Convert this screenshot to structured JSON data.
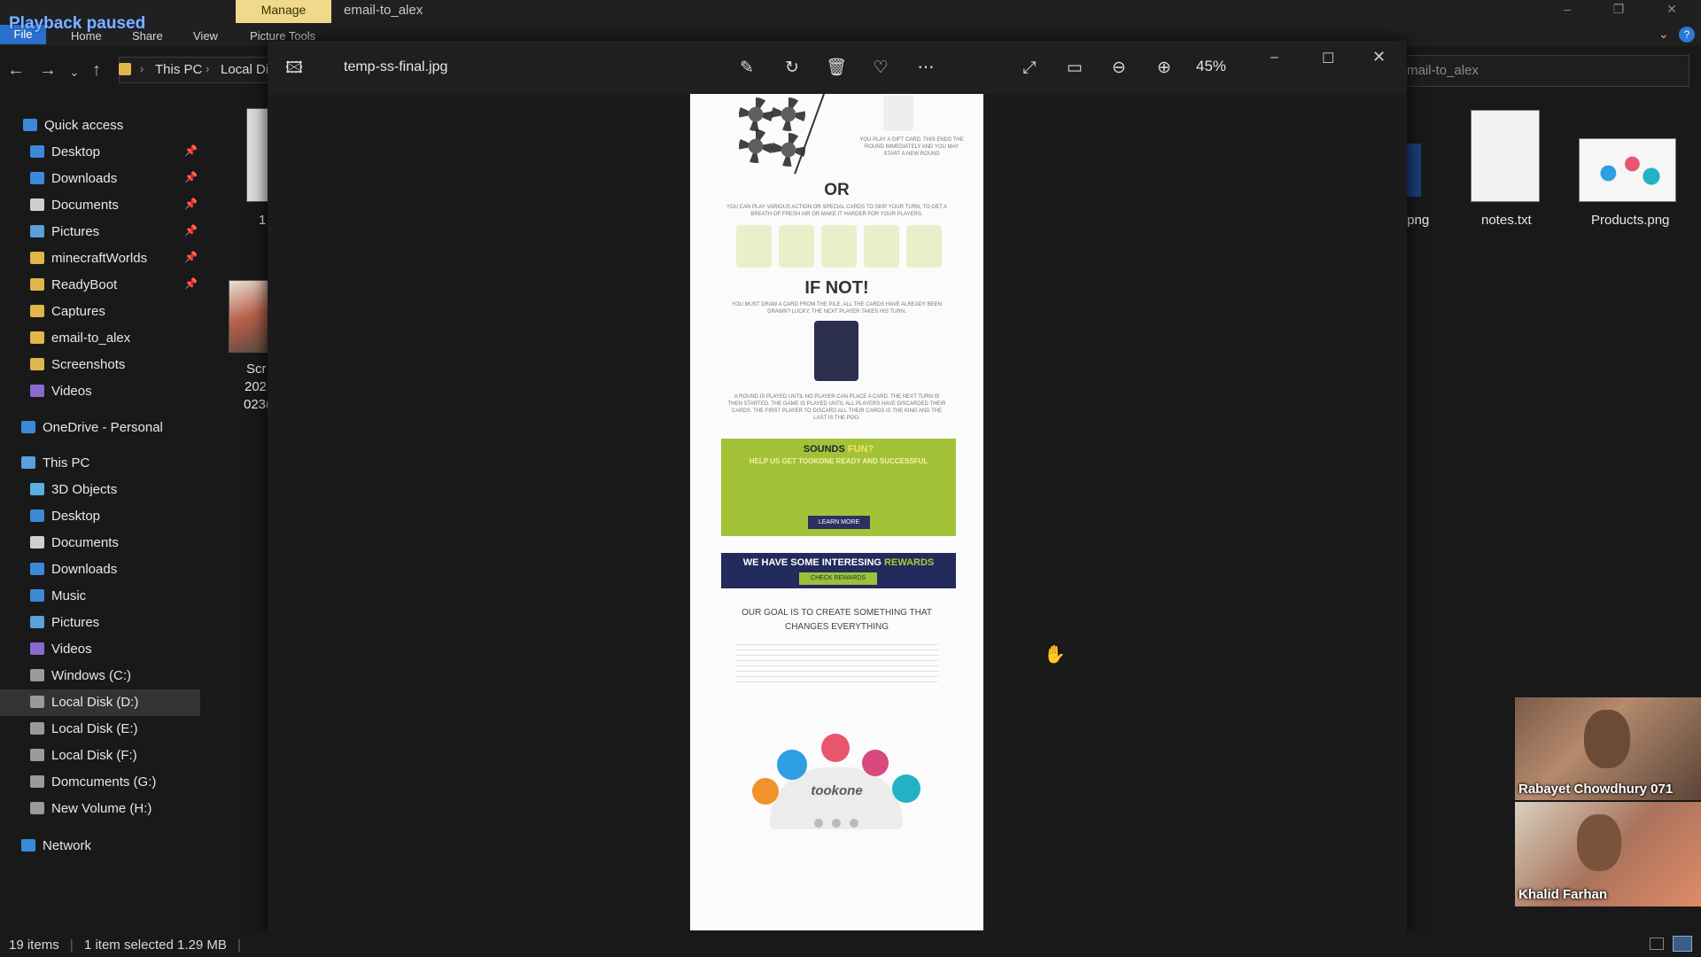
{
  "overlay": {
    "playback_status": "Playback paused"
  },
  "titlebar": {
    "manage_tab": "Manage",
    "window_title": "email-to_alex"
  },
  "ribbon": {
    "tabs": [
      "File",
      "Home",
      "Share",
      "View",
      "Picture Tools"
    ]
  },
  "address_bar": {
    "crumbs": [
      "This PC",
      "Local Di"
    ],
    "search_text": "mail-to_alex"
  },
  "sidebar": {
    "quick_access": "Quick access",
    "quick_items": [
      "Desktop",
      "Downloads",
      "Documents",
      "Pictures",
      "minecraftWorlds",
      "ReadyBoot",
      "Captures",
      "email-to_alex",
      "Screenshots",
      "Videos"
    ],
    "onedrive": "OneDrive - Personal",
    "this_pc": "This PC",
    "pc_items": [
      "3D Objects",
      "Desktop",
      "Documents",
      "Downloads",
      "Music",
      "Pictures",
      "Videos",
      "Windows (C:)",
      "Local Disk (D:)",
      "Local Disk (E:)",
      "Local Disk (F:)",
      "Domcuments (G:)",
      "New Volume (H:)"
    ],
    "network": "Network",
    "selected": "Local Disk (D:)"
  },
  "files": {
    "item1_label": "1",
    "item2_label_lines": [
      "Scr",
      "202",
      "023("
    ],
    "partial_png": ".png",
    "notes": "notes.txt",
    "products": "Products.png"
  },
  "viewer": {
    "file_name": "temp-ss-final.jpg",
    "zoom": "45%",
    "toolbar_icons": [
      "edit-icon",
      "rotate-icon",
      "delete-icon",
      "favorite-icon",
      "more-icon",
      "fullscreen-icon",
      "fit-icon",
      "zoom-out-icon",
      "zoom-in-icon"
    ]
  },
  "document": {
    "gift_text": "YOU PLAY A GIFT CARD. THIS ENDS THE ROUND IMMEDIATELY AND YOU MAY START A NEW ROUND",
    "or": "OR",
    "special_text": "YOU CAN PLAY VARIOUS ACTION OR SPECIAL CARDS TO SKIP YOUR TURN, TO GET A BREATH OF FRESH AIR OR MAKE IT HARDER FOR YOUR PLAYERS.",
    "if_not": "IF NOT!",
    "draw_text": "YOU MUST DRAW A CARD FROM THE PILE. ALL THE CARDS HAVE ALREADY BEEN DRAWN? LUCKY, THE NEXT PLAYER TAKES HIS TURN.",
    "round_text": "A ROUND IS PLAYED UNTIL NO PLAYER CAN PLACE A CARD. THE NEXT TURN IS THEN STARTED. THE GAME IS PLAYED UNTIL ALL PLAYERS HAVE DISCARDED THEIR CARDS. THE FIRST PLAYER TO DISCARD ALL THEIR CARDS IS THE KING AND THE LAST IS THE POO.",
    "sounds": "SOUNDS",
    "fun": "FUN?",
    "help": "HELP US GET TOOKONE READY AND SUCCESSFUL",
    "learn_more": "LEARN MORE",
    "rewards_prefix": "WE HAVE SOME INTERESING",
    "rewards_word": "REWARDS",
    "check_rewards": "CHECK REWARDS",
    "goal_line1": "OUR GOAL IS TO CREATE SOMETHING THAT",
    "goal_line2": "CHANGES EVERYTHING",
    "brand": "tookone"
  },
  "calls": {
    "participant1": "Rabayet Chowdhury 071",
    "participant2": "Khalid Farhan"
  },
  "statusbar": {
    "items": "19 items",
    "selected": "1 item selected  1.29 MB"
  }
}
